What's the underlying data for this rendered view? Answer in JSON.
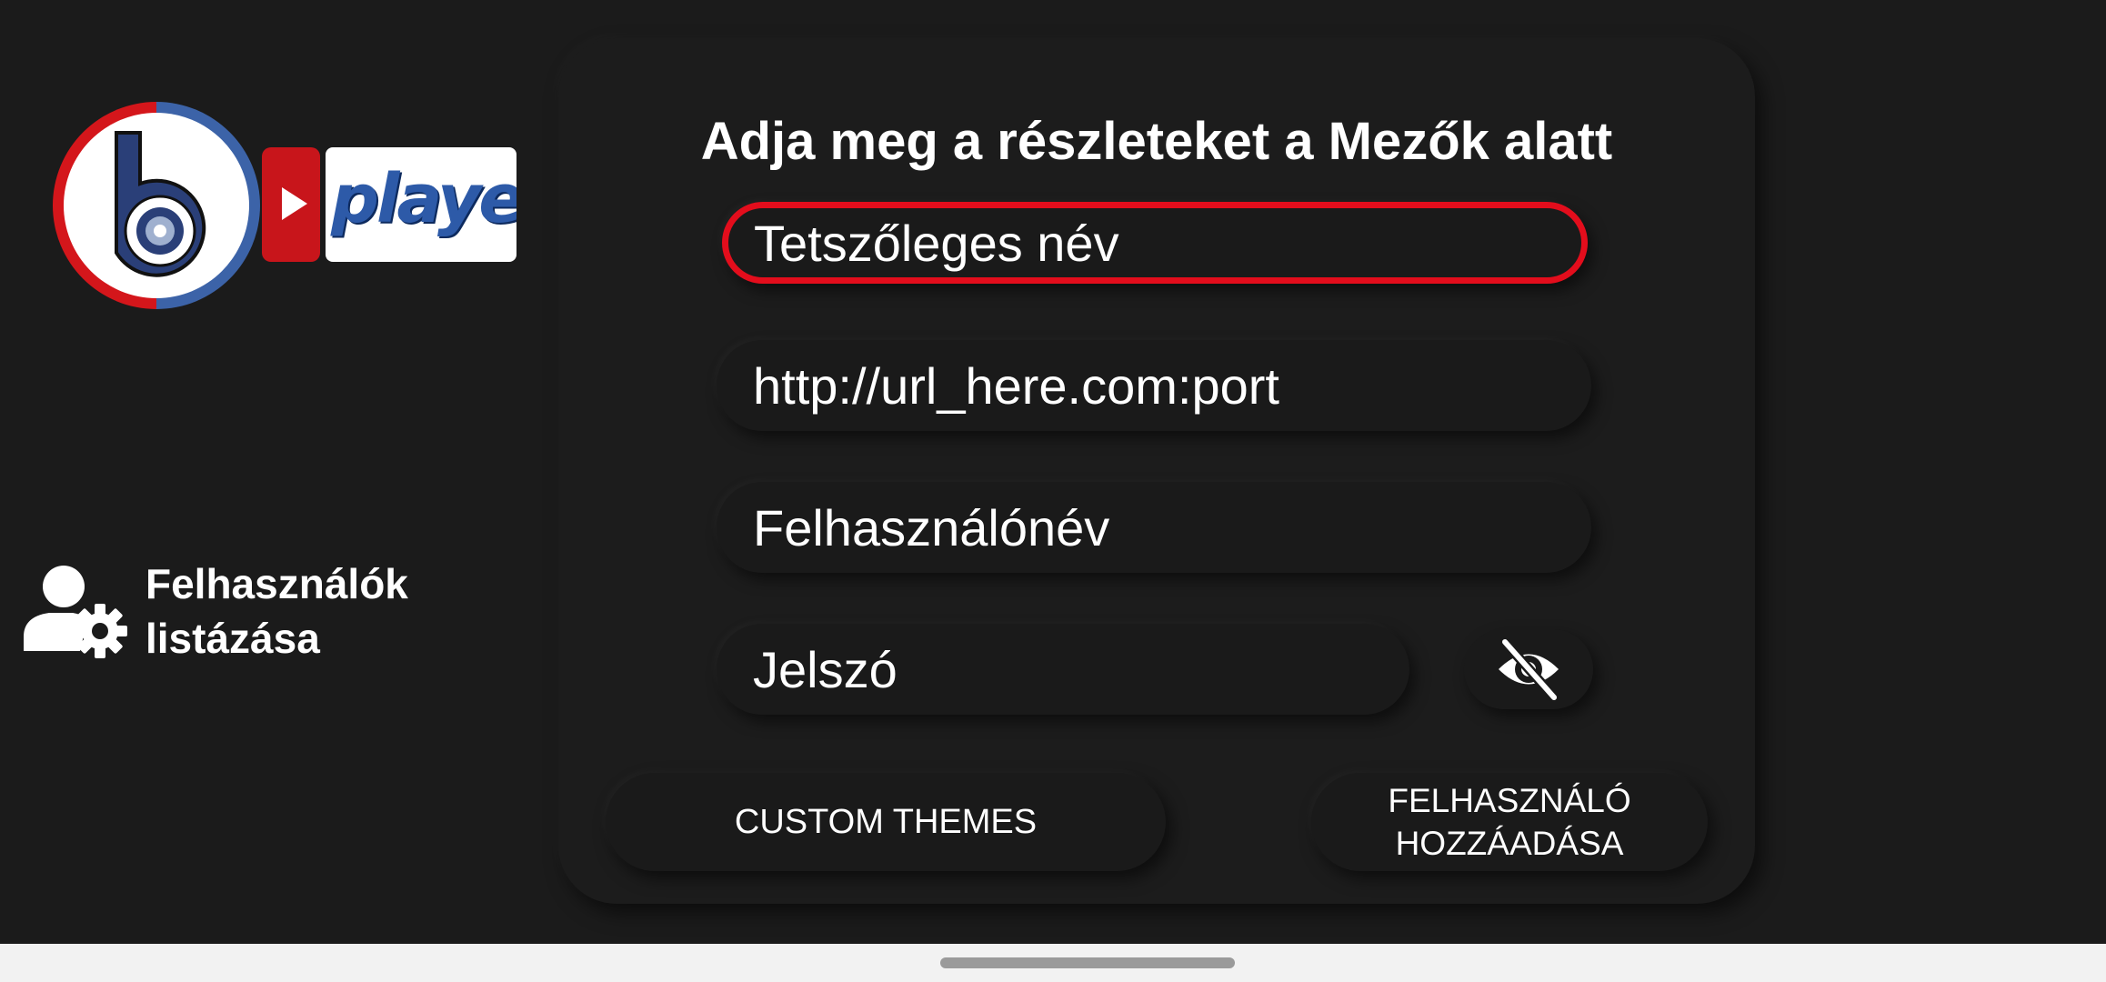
{
  "logo": {
    "wordmark": "player"
  },
  "sidebar": {
    "users_link_label": "Felhasználók\nlistázása"
  },
  "form": {
    "title": "Adja meg a részleteket a Mezők alatt",
    "name_placeholder": "Tetszőleges név",
    "url_placeholder": "http://url_here.com:port",
    "username_placeholder": "Felhasználónév",
    "password_placeholder": "Jelszó",
    "toggle_icon": "eye-off-icon"
  },
  "buttons": {
    "custom_themes": "CUSTOM THEMES",
    "add_user": "FELHASZNÁLÓ\nHOZZÁADÁSA"
  },
  "colors": {
    "accent": "#e30d1c",
    "background": "#1b1b1b",
    "logo_blue": "#3c63a8",
    "logo_red": "#d4161b"
  }
}
